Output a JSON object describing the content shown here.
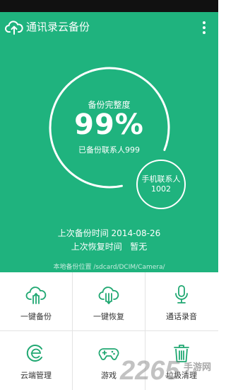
{
  "app": {
    "title": "通讯录云备份",
    "logo_icon": "cloud-upload-icon",
    "menu_icon": "more-vertical-icon"
  },
  "backup_status": {
    "title": "备份完整度",
    "percent": "99%",
    "percent_value": 0.99,
    "backed_up": "已备份联系人999"
  },
  "phone_contacts": {
    "label": "手机联系人",
    "count": "1002"
  },
  "history": {
    "last_backup": "上次备份时间 2014-08-26",
    "last_restore": "上次恢复时间   暂无"
  },
  "local_path": "本地备份位置 /sdcard/DCIM/Camera/",
  "grid": [
    {
      "label": "一键备份",
      "icon": "cloud-upload-icon"
    },
    {
      "label": "一键恢复",
      "icon": "cloud-download-icon"
    },
    {
      "label": "通话录音",
      "icon": "microphone-icon"
    },
    {
      "label": "云端管理",
      "icon": "cloud-manage-icon"
    },
    {
      "label": "游戏",
      "icon": "gamepad-icon"
    },
    {
      "label": "垃圾清理",
      "icon": "trash-icon"
    }
  ],
  "watermark": {
    "number": "2265",
    "text": "手游网"
  },
  "colors": {
    "brand_green": "#1fb37e",
    "icon_green": "#20a872",
    "status_bar": "#111111"
  }
}
